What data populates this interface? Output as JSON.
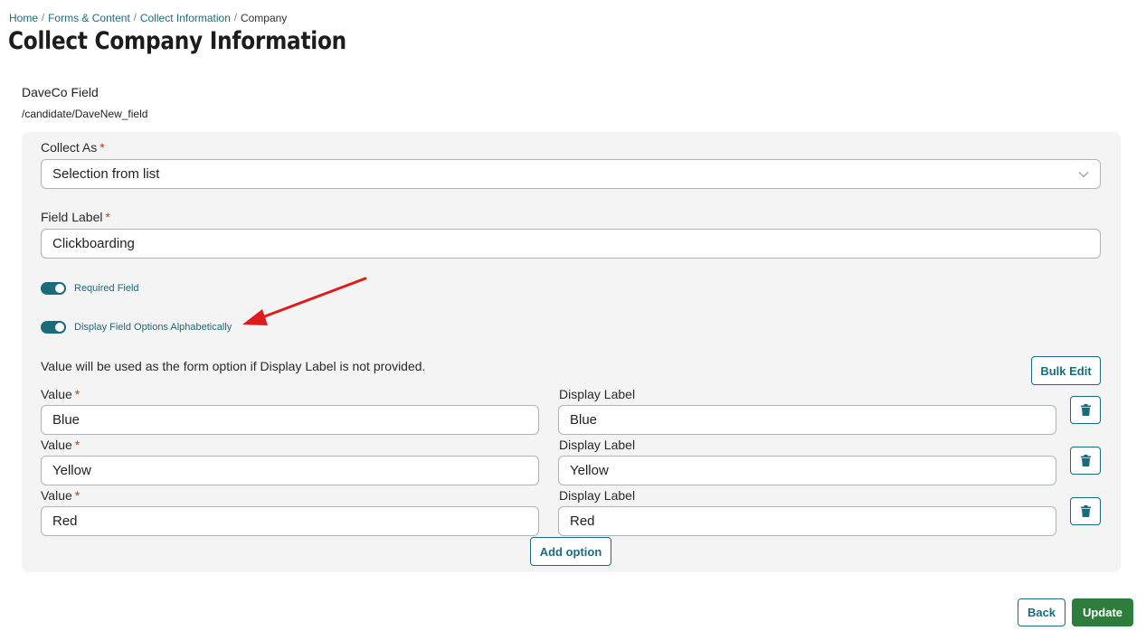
{
  "breadcrumb": {
    "items": [
      "Home",
      "Forms & Content",
      "Collect Information"
    ],
    "current": "Company",
    "separator": "/"
  },
  "page_title": "Collect Company Information",
  "field": {
    "name": "DaveCo Field",
    "path": "/candidate/DaveNew_field"
  },
  "collect_as": {
    "label": "Collect As",
    "required_mark": "*",
    "value": "Selection from list"
  },
  "field_label": {
    "label": "Field Label",
    "required_mark": "*",
    "value": "Clickboarding"
  },
  "toggles": {
    "required_field": {
      "label": "Required Field",
      "on": true
    },
    "display_alphabetically": {
      "label": "Display Field Options Alphabetically",
      "on": true
    }
  },
  "options_note": "Value will be used as the form option if Display Label is not provided.",
  "bulk_edit_label": "Bulk Edit",
  "options": {
    "value_label": "Value",
    "display_label": "Display Label",
    "required_mark": "*",
    "rows": [
      {
        "value": "Blue",
        "display": "Blue"
      },
      {
        "value": "Yellow",
        "display": "Yellow"
      },
      {
        "value": "Red",
        "display": "Red"
      }
    ]
  },
  "add_option_label": "Add option",
  "footer": {
    "back_label": "Back",
    "update_label": "Update"
  },
  "colors": {
    "accent": "#1b6b7a",
    "primary_button": "#2e7d3c",
    "required": "#d0342c",
    "annotation_arrow": "#e01b1b",
    "panel_bg": "#f4f4f4"
  }
}
